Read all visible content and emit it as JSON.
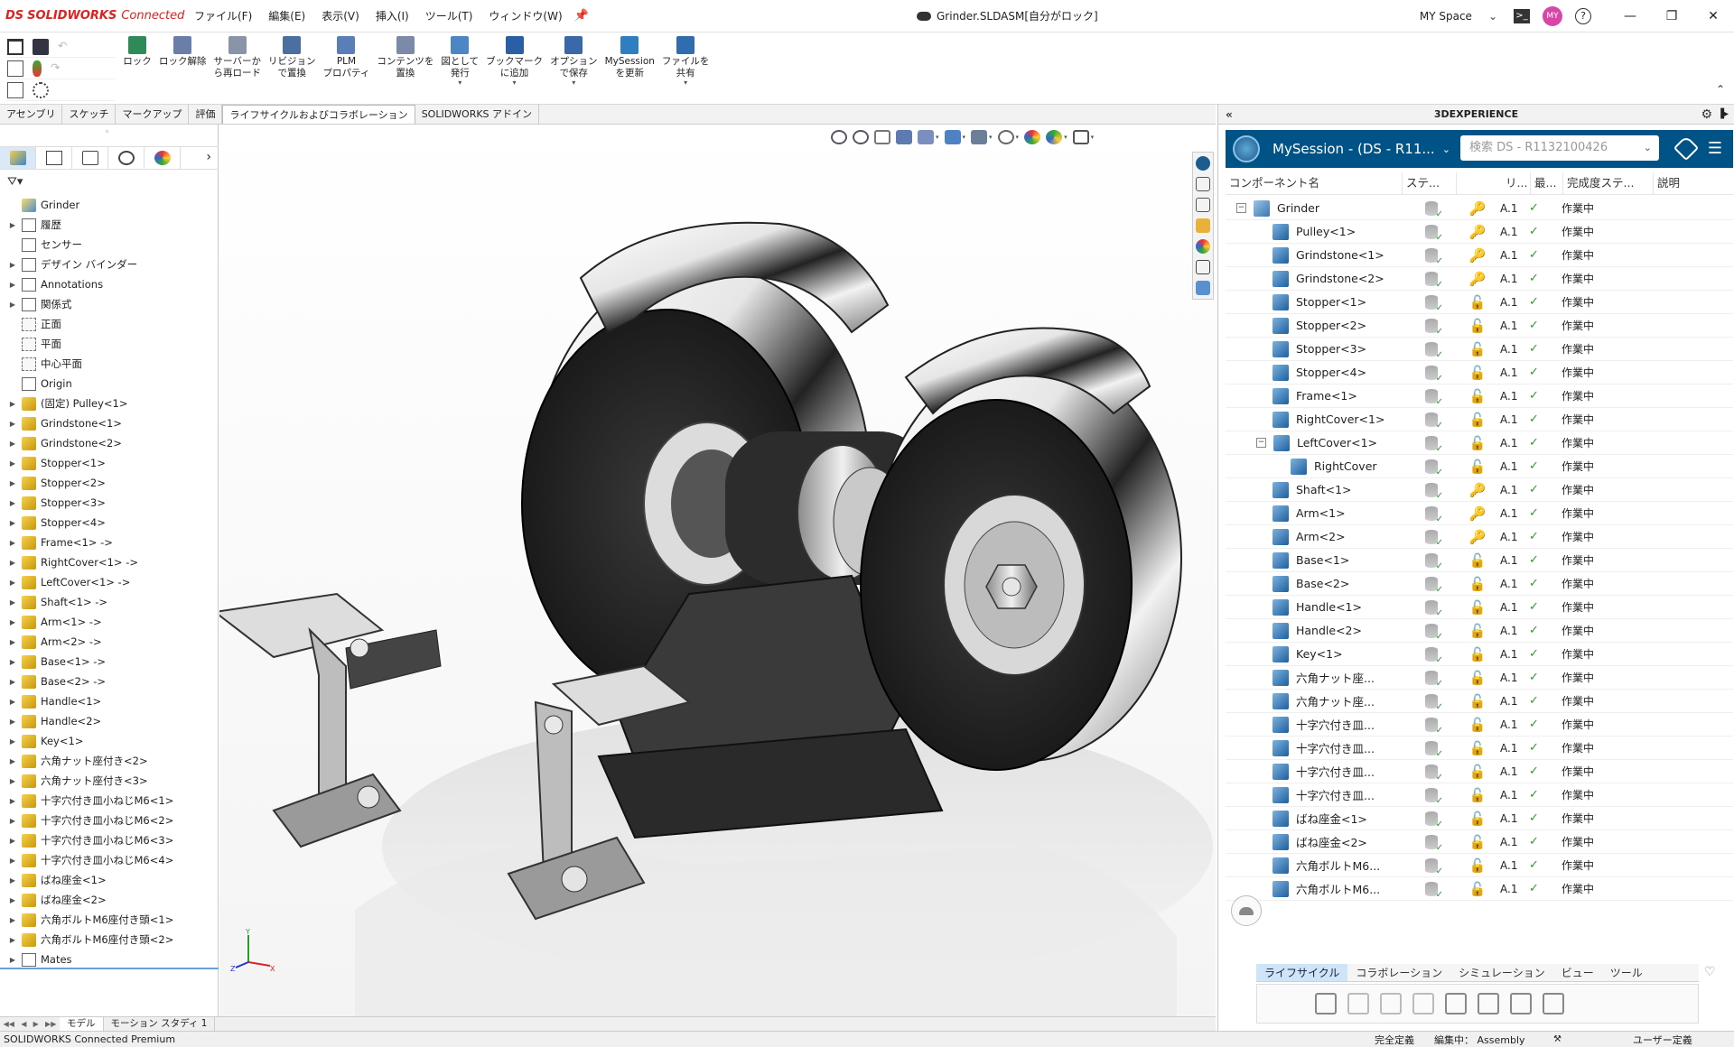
{
  "app": {
    "logo_ds": "DS",
    "logo_sw": "SOLIDWORKS",
    "logo_connected": "Connected",
    "menus": [
      "ファイル(F)",
      "編集(E)",
      "表示(V)",
      "挿入(I)",
      "ツール(T)",
      "ウィンドウ(W)"
    ],
    "doc_title": "Grinder.SLDASM[自分がロック]",
    "space": "MY Space",
    "avatar": "MY",
    "help": "?"
  },
  "ribbon": {
    "buttons": [
      {
        "label": "ロック",
        "icon": "lock-icon",
        "color": "#2e8b57"
      },
      {
        "label": "ロック解除",
        "icon": "unlock-icon",
        "color": "#6a7ea8"
      },
      {
        "label": "サーバーか\nら再ロード",
        "icon": "reload-icon",
        "color": "#8a94a8"
      },
      {
        "label": "リビジョン\nで置換",
        "icon": "replace-icon",
        "color": "#4a6fa0"
      },
      {
        "label": "PLM\nプロパティ",
        "icon": "plm-icon",
        "color": "#5a7fb8"
      },
      {
        "label": "コンテンツを\n置換",
        "icon": "content-icon",
        "color": "#7a8aa8"
      },
      {
        "label": "図として\n発行",
        "icon": "publish-icon",
        "color": "#4d86c6"
      },
      {
        "label": "ブックマーク\nに追加",
        "icon": "bookmark-icon",
        "color": "#2a5fa5"
      },
      {
        "label": "オプション\nで保存",
        "icon": "save-options-icon",
        "color": "#3a68a8"
      },
      {
        "label": "MySession\nを更新",
        "icon": "refresh-icon",
        "color": "#2f7ec2"
      },
      {
        "label": "ファイルを\n共有",
        "icon": "share-icon",
        "color": "#2f6db0"
      }
    ]
  },
  "command_tabs": [
    "アセンブリ",
    "スケッチ",
    "マークアップ",
    "評価",
    "ライフサイクルおよびコラボレーション",
    "SOLIDWORKS アドイン"
  ],
  "feature_tree": {
    "items": [
      {
        "label": "Grinder",
        "icon": "assembly-icon",
        "toggle": ""
      },
      {
        "label": "履歴",
        "icon": "history-icon",
        "toggle": "▶"
      },
      {
        "label": "センサー",
        "icon": "sensor-icon",
        "toggle": ""
      },
      {
        "label": "デザイン バインダー",
        "icon": "binder-icon",
        "toggle": "▶"
      },
      {
        "label": "Annotations",
        "icon": "annotation-icon",
        "toggle": "▶"
      },
      {
        "label": "関係式",
        "icon": "equation-icon",
        "toggle": "▶"
      },
      {
        "label": "正面",
        "icon": "plane-icon",
        "toggle": ""
      },
      {
        "label": "平面",
        "icon": "plane-icon",
        "toggle": ""
      },
      {
        "label": "中心平面",
        "icon": "plane-icon",
        "toggle": ""
      },
      {
        "label": "Origin",
        "icon": "origin-icon",
        "toggle": ""
      },
      {
        "label": "(固定) Pulley<1>",
        "icon": "part-icon",
        "toggle": "▶"
      },
      {
        "label": "Grindstone<1>",
        "icon": "part-icon",
        "toggle": "▶"
      },
      {
        "label": "Grindstone<2>",
        "icon": "part-icon",
        "toggle": "▶"
      },
      {
        "label": "Stopper<1>",
        "icon": "part-icon",
        "toggle": "▶"
      },
      {
        "label": "Stopper<2>",
        "icon": "part-icon",
        "toggle": "▶"
      },
      {
        "label": "Stopper<3>",
        "icon": "part-icon",
        "toggle": "▶"
      },
      {
        "label": "Stopper<4>",
        "icon": "part-icon",
        "toggle": "▶"
      },
      {
        "label": "Frame<1> ->",
        "icon": "part-icon",
        "toggle": "▶"
      },
      {
        "label": "RightCover<1> ->",
        "icon": "part-icon",
        "toggle": "▶"
      },
      {
        "label": "LeftCover<1> ->",
        "icon": "part-icon",
        "toggle": "▶"
      },
      {
        "label": "Shaft<1> ->",
        "icon": "part-icon",
        "toggle": "▶"
      },
      {
        "label": "Arm<1> ->",
        "icon": "part-icon",
        "toggle": "▶"
      },
      {
        "label": "Arm<2> ->",
        "icon": "part-icon",
        "toggle": "▶"
      },
      {
        "label": "Base<1> ->",
        "icon": "part-icon",
        "toggle": "▶"
      },
      {
        "label": "Base<2> ->",
        "icon": "part-icon",
        "toggle": "▶"
      },
      {
        "label": "Handle<1>",
        "icon": "part-icon",
        "toggle": "▶"
      },
      {
        "label": "Handle<2>",
        "icon": "part-icon",
        "toggle": "▶"
      },
      {
        "label": "Key<1>",
        "icon": "part-icon",
        "toggle": "▶"
      },
      {
        "label": "六角ナット座付き<2>",
        "icon": "part-icon",
        "toggle": "▶"
      },
      {
        "label": "六角ナット座付き<3>",
        "icon": "part-icon",
        "toggle": "▶"
      },
      {
        "label": "十字穴付き皿小ねじM6<1>",
        "icon": "part-icon",
        "toggle": "▶"
      },
      {
        "label": "十字穴付き皿小ねじM6<2>",
        "icon": "part-icon",
        "toggle": "▶"
      },
      {
        "label": "十字穴付き皿小ねじM6<3>",
        "icon": "part-icon",
        "toggle": "▶"
      },
      {
        "label": "十字穴付き皿小ねじM6<4>",
        "icon": "part-icon",
        "toggle": "▶"
      },
      {
        "label": "ばね座金<1>",
        "icon": "part-icon",
        "toggle": "▶"
      },
      {
        "label": "ばね座金<2>",
        "icon": "part-icon",
        "toggle": "▶"
      },
      {
        "label": "六角ボルトM6座付き頭<1>",
        "icon": "part-icon",
        "toggle": "▶"
      },
      {
        "label": "六角ボルトM6座付き頭<2>",
        "icon": "part-icon",
        "toggle": "▶"
      },
      {
        "label": "Mates",
        "icon": "mates-icon",
        "toggle": "▶"
      }
    ]
  },
  "bottom_tabs": [
    "モデル",
    "モーション スタディ 1"
  ],
  "triad": {
    "x": "X",
    "y": "Y",
    "z": "Z"
  },
  "panel": {
    "title": "3DEXPERIENCE",
    "session_name": "MySession - (DS - R11...",
    "search_placeholder": "検索 DS - R1132100426",
    "columns": [
      "コンポーネント名",
      "ステ...",
      "",
      "リ...",
      "最...",
      "完成度ステ...",
      "説明"
    ],
    "rows": [
      {
        "name": "Grinder",
        "lock": "key",
        "rev": "A.1",
        "maturity": "作業中",
        "indent": 0,
        "minus": true,
        "top": true
      },
      {
        "name": "Pulley<1>",
        "lock": "key",
        "rev": "A.1",
        "maturity": "作業中",
        "indent": 1
      },
      {
        "name": "Grindstone<1>",
        "lock": "key",
        "rev": "A.1",
        "maturity": "作業中",
        "indent": 1
      },
      {
        "name": "Grindstone<2>",
        "lock": "key",
        "rev": "A.1",
        "maturity": "作業中",
        "indent": 1
      },
      {
        "name": "Stopper<1>",
        "lock": "open",
        "rev": "A.1",
        "maturity": "作業中",
        "indent": 1
      },
      {
        "name": "Stopper<2>",
        "lock": "open",
        "rev": "A.1",
        "maturity": "作業中",
        "indent": 1
      },
      {
        "name": "Stopper<3>",
        "lock": "open",
        "rev": "A.1",
        "maturity": "作業中",
        "indent": 1
      },
      {
        "name": "Stopper<4>",
        "lock": "open",
        "rev": "A.1",
        "maturity": "作業中",
        "indent": 1
      },
      {
        "name": "Frame<1>",
        "lock": "open",
        "rev": "A.1",
        "maturity": "作業中",
        "indent": 1
      },
      {
        "name": "RightCover<1>",
        "lock": "open",
        "rev": "A.1",
        "maturity": "作業中",
        "indent": 1
      },
      {
        "name": "LeftCover<1>",
        "lock": "open",
        "rev": "A.1",
        "maturity": "作業中",
        "indent": 1,
        "minus": true
      },
      {
        "name": "RightCover",
        "lock": "open",
        "rev": "A.1",
        "maturity": "作業中",
        "indent": 2
      },
      {
        "name": "Shaft<1>",
        "lock": "key",
        "rev": "A.1",
        "maturity": "作業中",
        "indent": 1
      },
      {
        "name": "Arm<1>",
        "lock": "key",
        "rev": "A.1",
        "maturity": "作業中",
        "indent": 1
      },
      {
        "name": "Arm<2>",
        "lock": "key",
        "rev": "A.1",
        "maturity": "作業中",
        "indent": 1
      },
      {
        "name": "Base<1>",
        "lock": "open",
        "rev": "A.1",
        "maturity": "作業中",
        "indent": 1
      },
      {
        "name": "Base<2>",
        "lock": "open",
        "rev": "A.1",
        "maturity": "作業中",
        "indent": 1
      },
      {
        "name": "Handle<1>",
        "lock": "open",
        "rev": "A.1",
        "maturity": "作業中",
        "indent": 1
      },
      {
        "name": "Handle<2>",
        "lock": "open",
        "rev": "A.1",
        "maturity": "作業中",
        "indent": 1
      },
      {
        "name": "Key<1>",
        "lock": "open",
        "rev": "A.1",
        "maturity": "作業中",
        "indent": 1
      },
      {
        "name": "六角ナット座...",
        "lock": "open",
        "rev": "A.1",
        "maturity": "作業中",
        "indent": 1
      },
      {
        "name": "六角ナット座...",
        "lock": "open",
        "rev": "A.1",
        "maturity": "作業中",
        "indent": 1
      },
      {
        "name": "十字穴付き皿...",
        "lock": "open",
        "rev": "A.1",
        "maturity": "作業中",
        "indent": 1
      },
      {
        "name": "十字穴付き皿...",
        "lock": "open",
        "rev": "A.1",
        "maturity": "作業中",
        "indent": 1
      },
      {
        "name": "十字穴付き皿...",
        "lock": "open",
        "rev": "A.1",
        "maturity": "作業中",
        "indent": 1
      },
      {
        "name": "十字穴付き皿...",
        "lock": "open",
        "rev": "A.1",
        "maturity": "作業中",
        "indent": 1
      },
      {
        "name": "ばね座金<1>",
        "lock": "open",
        "rev": "A.1",
        "maturity": "作業中",
        "indent": 1
      },
      {
        "name": "ばね座金<2>",
        "lock": "open",
        "rev": "A.1",
        "maturity": "作業中",
        "indent": 1
      },
      {
        "name": "六角ボルトM6...",
        "lock": "open",
        "rev": "A.1",
        "maturity": "作業中",
        "indent": 1
      },
      {
        "name": "六角ボルトM6...",
        "lock": "open",
        "rev": "A.1",
        "maturity": "作業中",
        "indent": 1
      }
    ],
    "tabs": [
      "ライフサイクル",
      "コラボレーション",
      "シミュレーション",
      "ビュー",
      "ツール"
    ],
    "active_tab": "ライフサイクル"
  },
  "status": {
    "product": "SOLIDWORKS Connected Premium",
    "defined": "完全定義",
    "editing": "編集中： Assembly",
    "user_defined": "ユーザー定義"
  }
}
